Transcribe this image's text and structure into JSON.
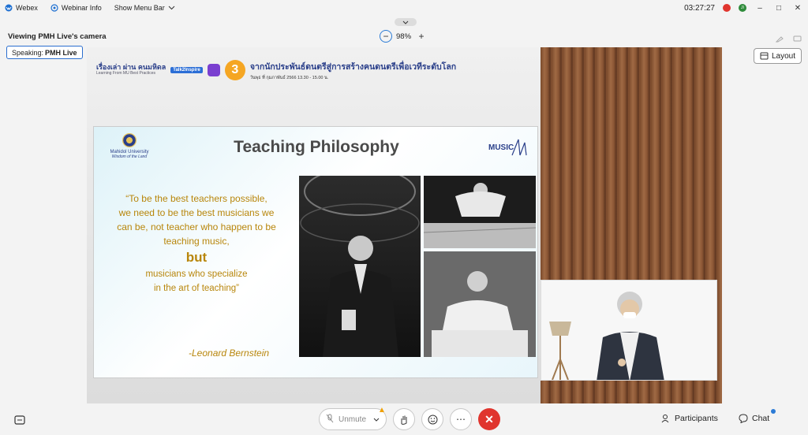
{
  "titlebar": {
    "app": "Webex",
    "webinar_info": "Webinar Info",
    "menu": "Show Menu Bar",
    "time": "03:27:27",
    "avatar_letter": "JI"
  },
  "viewing": "Viewing PMH Live's camera",
  "zoom_level": "98%",
  "speaking": {
    "prefix": "Speaking:",
    "name": "PMH Live"
  },
  "layout_label": "Layout",
  "banner": {
    "logo_main": "เรื่องเล่า ผ่าน คนมหิดล",
    "logo_sub": "Learning From MU Best Practices",
    "talk": "Talk2Inspire",
    "episode": "3",
    "title": "จากนักประพันธ์ดนตรีสู่การสร้างคนดนตรีเพื่อเวทีระดับโลก",
    "date": "วันพุธ ที่ กุมภาพันธ์ 2566 13.30 - 15.00 น."
  },
  "slide": {
    "university": "Mahidol University",
    "tagline": "Wisdom of the Land",
    "title": "Teaching Philosophy",
    "quote_lines": [
      "“To be the best teachers possible,",
      "we need to be the best musicians we",
      "can be, not teacher who happen to be",
      "teaching music,"
    ],
    "quote_but": "but",
    "quote_end": [
      "musicians who specialize",
      "in the art of teaching”"
    ],
    "author": "-Leonard Bernstein",
    "music_logo": "MUSIC"
  },
  "bottombar": {
    "unmute": "Unmute",
    "participants": "Participants",
    "chat": "Chat"
  },
  "colors": {
    "accent": "#2b7bd6",
    "end_call": "#e0352e",
    "quote_gold": "#b8860b"
  }
}
